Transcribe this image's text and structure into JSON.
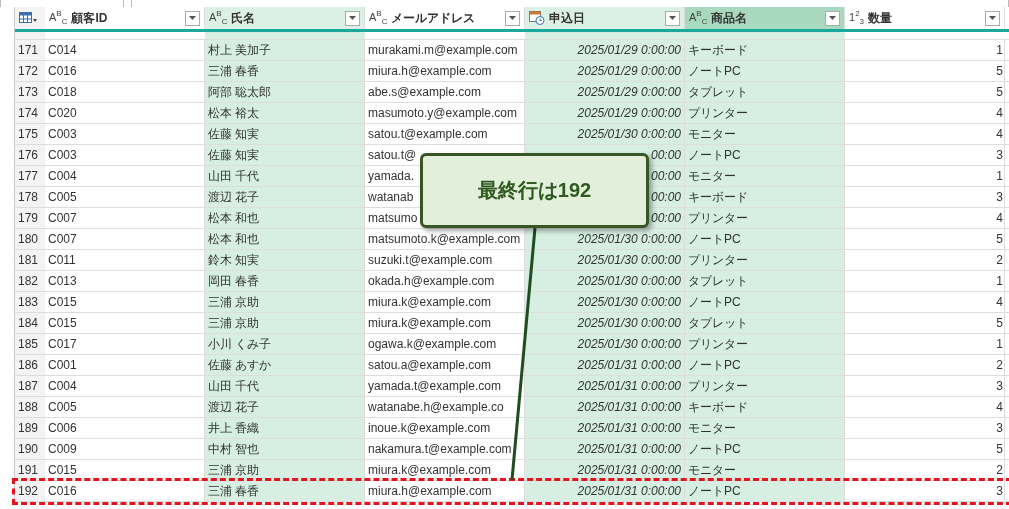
{
  "columns": [
    {
      "name": "顧客ID",
      "kind": "text",
      "type_label": "A$^{B}$$_{C}$",
      "highlighted": false,
      "selected": false
    },
    {
      "name": "氏名",
      "kind": "text",
      "type_label": "A$^{B}$$_{C}$",
      "highlighted": true,
      "selected": false
    },
    {
      "name": "メールアドレス",
      "kind": "text",
      "type_label": "A$^{B}$$_{C}$",
      "highlighted": false,
      "selected": false
    },
    {
      "name": "申込日",
      "kind": "datetime",
      "highlighted": true,
      "selected": false
    },
    {
      "name": "商品名",
      "kind": "text",
      "type_label": "A$^{B}$$_{C}$",
      "highlighted": true,
      "selected": true
    },
    {
      "name": "数量",
      "kind": "number",
      "type_label": "1$^{2}$$_{3}$",
      "highlighted": false,
      "selected": false
    }
  ],
  "rows": [
    {
      "index": "171",
      "marked": false,
      "cells": [
        "C014",
        "村上 美加子",
        "murakami.m@example.com",
        "2025/01/29 0:00:00",
        "キーボード",
        "1"
      ]
    },
    {
      "index": "172",
      "marked": false,
      "cells": [
        "C016",
        "三浦 春香",
        "miura.h@example.com",
        "2025/01/29 0:00:00",
        "ノートPC",
        "5"
      ]
    },
    {
      "index": "173",
      "marked": false,
      "cells": [
        "C018",
        "阿部 聡太郎",
        "abe.s@example.com",
        "2025/01/29 0:00:00",
        "タブレット",
        "5"
      ]
    },
    {
      "index": "174",
      "marked": false,
      "cells": [
        "C020",
        "松本 裕太",
        "masumoto.y@example.com",
        "2025/01/29 0:00:00",
        "プリンター",
        "4"
      ]
    },
    {
      "index": "175",
      "marked": false,
      "cells": [
        "C003",
        "佐藤 知実",
        "satou.t@example.com",
        "2025/01/30 0:00:00",
        "モニター",
        "4"
      ]
    },
    {
      "index": "176",
      "marked": false,
      "cells": [
        "C003",
        "佐藤 知実",
        "satou.t@",
        "00:00",
        "ノートPC",
        "3"
      ]
    },
    {
      "index": "177",
      "marked": false,
      "cells": [
        "C004",
        "山田 千代",
        "yamada.",
        "00:00",
        "モニター",
        "1"
      ]
    },
    {
      "index": "178",
      "marked": false,
      "cells": [
        "C005",
        "渡辺 花子",
        "watanab",
        "00:00",
        "キーボード",
        "3"
      ]
    },
    {
      "index": "179",
      "marked": false,
      "cells": [
        "C007",
        "松本 和也",
        "matsumo",
        "00:00",
        "プリンター",
        "4"
      ]
    },
    {
      "index": "180",
      "marked": false,
      "cells": [
        "C007",
        "松本 和也",
        "matsumoto.k@example.com",
        "2025/01/30 0:00:00",
        "ノートPC",
        "5"
      ]
    },
    {
      "index": "181",
      "marked": false,
      "cells": [
        "C011",
        "鈴木 知実",
        "suzuki.t@example.com",
        "2025/01/30 0:00:00",
        "プリンター",
        "2"
      ]
    },
    {
      "index": "182",
      "marked": false,
      "cells": [
        "C013",
        "岡田 春香",
        "okada.h@example.com",
        "2025/01/30 0:00:00",
        "タブレット",
        "1"
      ]
    },
    {
      "index": "183",
      "marked": false,
      "cells": [
        "C015",
        "三浦 京助",
        "miura.k@example.com",
        "2025/01/30 0:00:00",
        "ノートPC",
        "4"
      ]
    },
    {
      "index": "184",
      "marked": false,
      "cells": [
        "C015",
        "三浦 京助",
        "miura.k@example.com",
        "2025/01/30 0:00:00",
        "タブレット",
        "5"
      ]
    },
    {
      "index": "185",
      "marked": false,
      "cells": [
        "C017",
        "小川 くみ子",
        "ogawa.k@example.com",
        "2025/01/30 0:00:00",
        "プリンター",
        "1"
      ]
    },
    {
      "index": "186",
      "marked": false,
      "cells": [
        "C001",
        "佐藤 あすか",
        "satou.a@example.com",
        "2025/01/31 0:00:00",
        "ノートPC",
        "2"
      ]
    },
    {
      "index": "187",
      "marked": false,
      "cells": [
        "C004",
        "山田 千代",
        "yamada.t@example.com",
        "2025/01/31 0:00:00",
        "プリンター",
        "3"
      ]
    },
    {
      "index": "188",
      "marked": false,
      "cells": [
        "C005",
        "渡辺 花子",
        "watanabe.h@example.co",
        "2025/01/31 0:00:00",
        "キーボード",
        "4"
      ]
    },
    {
      "index": "189",
      "marked": false,
      "cells": [
        "C006",
        "井上 香織",
        "inoue.k@example.com",
        "2025/01/31 0:00:00",
        "モニター",
        "3"
      ]
    },
    {
      "index": "190",
      "marked": false,
      "cells": [
        "C009",
        "中村 智也",
        "nakamura.t@example.com",
        "2025/01/31 0:00:00",
        "ノートPC",
        "5"
      ]
    },
    {
      "index": "191",
      "marked": false,
      "cells": [
        "C015",
        "三浦 京助",
        "miura.k@example.com",
        "2025/01/31 0:00:00",
        "モニター",
        "2"
      ]
    },
    {
      "index": "192",
      "marked": true,
      "cells": [
        "C016",
        "三浦 春香",
        "miura.h@example.com",
        "2025/01/31 0:00:00",
        "ノートPC",
        "3"
      ]
    }
  ],
  "callout": {
    "text": "最終行は192"
  }
}
